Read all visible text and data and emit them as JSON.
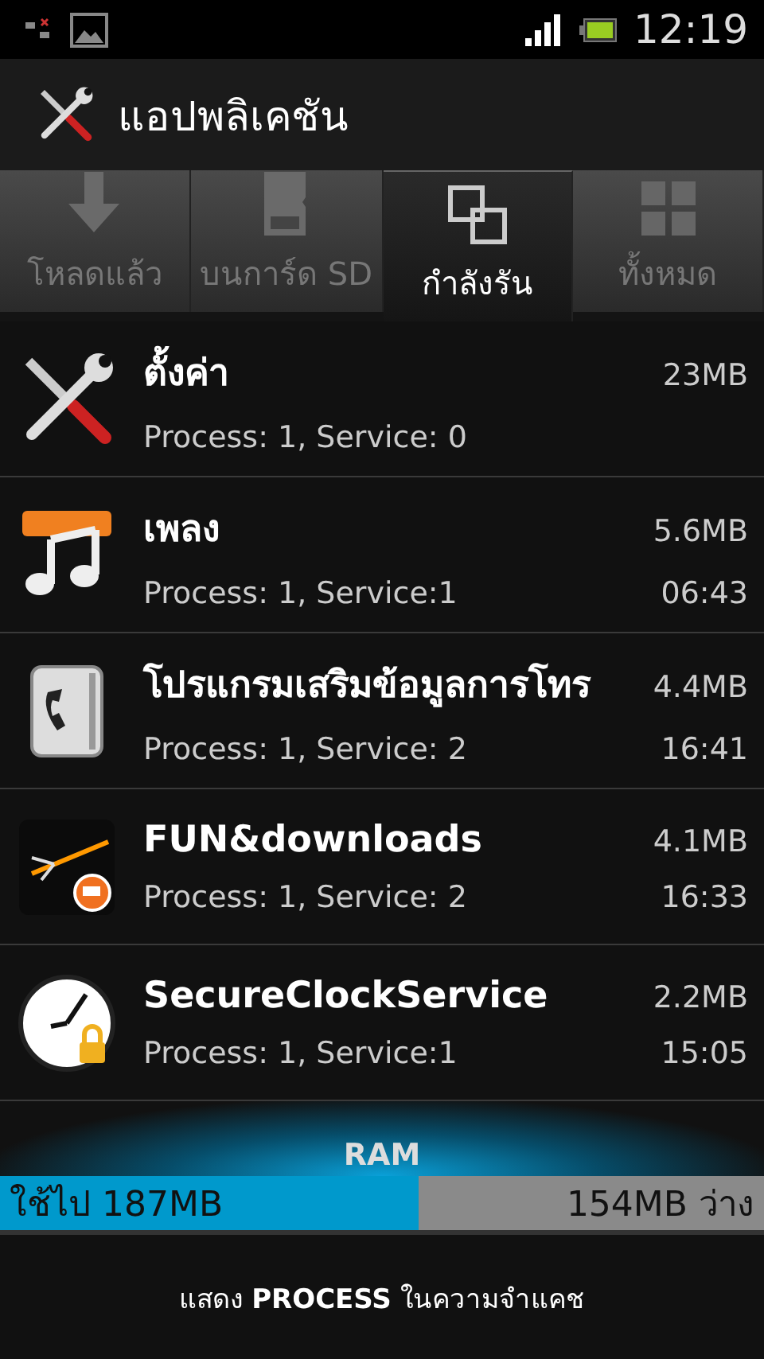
{
  "status_bar": {
    "time": "12:19"
  },
  "header": {
    "title": "แอปพลิเคชัน"
  },
  "tabs": [
    {
      "label": "โหลดแล้ว",
      "kind": "download",
      "selected": false
    },
    {
      "label": "บนการ์ด SD",
      "kind": "sdcard",
      "selected": false
    },
    {
      "label": "กำลังรัน",
      "kind": "running",
      "selected": true
    },
    {
      "label": "ทั้งหมด",
      "kind": "all",
      "selected": false
    }
  ],
  "apps": [
    {
      "name": "ตั้งค่า",
      "kind": "tools",
      "size": "23MB",
      "details": "Process: 1, Service: 0"
    },
    {
      "name": "เพลง",
      "kind": "music",
      "size": "5.6MB",
      "details": "Process: 1, Service:1",
      "time": "06:43"
    },
    {
      "name": "โปรแกรมเสริมข้อมูลการโทร",
      "kind": "phonebook",
      "size": "4.4MB",
      "details": "Process: 1, Service: 2",
      "time": "16:41"
    },
    {
      "name": "FUN&downloads",
      "kind": "fun",
      "size": "4.1MB",
      "details": "Process: 1, Service: 2",
      "time": "16:33"
    },
    {
      "name": "SecureClockService",
      "kind": "clock",
      "size": "2.2MB",
      "details": "Process: 1, Service:1",
      "time": "15:05"
    }
  ],
  "ram": {
    "label": "RAM",
    "level": 0.548,
    "used": "ใช้ไป 187MB",
    "free": "154MB ว่าง"
  },
  "footer_button": "แสดง **PROCESS** ในความจำแคช"
}
